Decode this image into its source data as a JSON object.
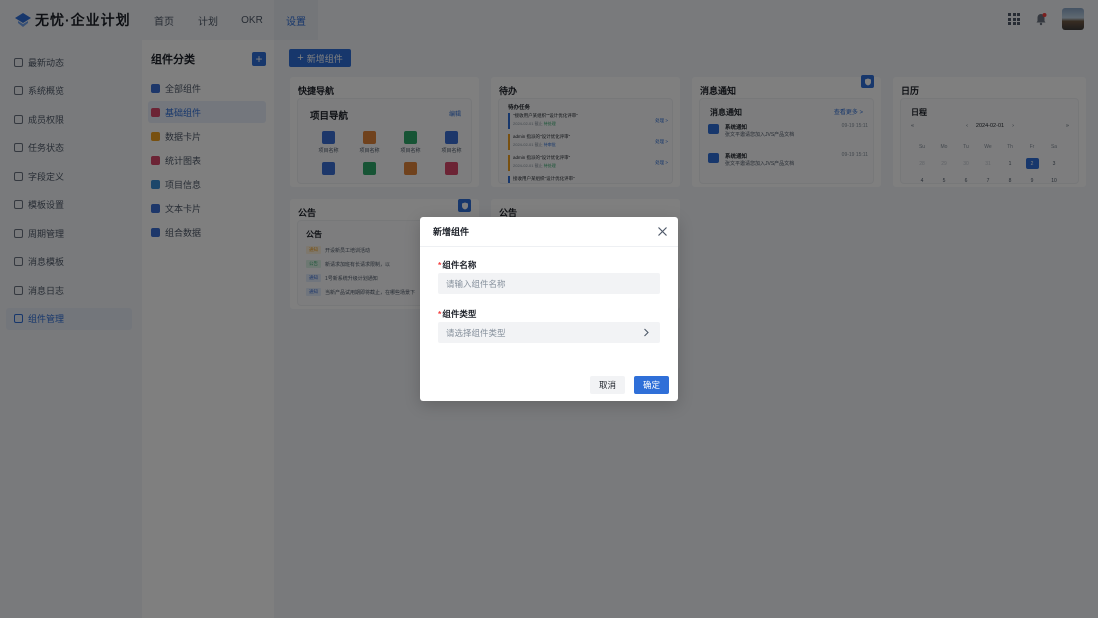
{
  "app": {
    "title": "无忧·企业计划"
  },
  "topnav": [
    {
      "label": "首页",
      "active": false
    },
    {
      "label": "计划",
      "active": false
    },
    {
      "label": "OKR",
      "active": false
    },
    {
      "label": "设置",
      "active": true
    }
  ],
  "sidebar": {
    "items": [
      {
        "label": "最新动态",
        "icon": "send-icon"
      },
      {
        "label": "系统概览",
        "icon": "sliders-icon"
      },
      {
        "label": "成员权限",
        "icon": "key-icon"
      },
      {
        "label": "任务状态",
        "icon": "checklist-icon"
      },
      {
        "label": "字段定义",
        "icon": "text-icon"
      },
      {
        "label": "模板设置",
        "icon": "template-icon"
      },
      {
        "label": "周期管理",
        "icon": "clock-icon"
      },
      {
        "label": "消息模板",
        "icon": "bell-icon"
      },
      {
        "label": "消息日志",
        "icon": "log-icon"
      },
      {
        "label": "组件管理",
        "icon": "component-icon",
        "active": true
      }
    ]
  },
  "categories": {
    "title": "组件分类",
    "items": [
      {
        "label": "全部组件",
        "color": "#3b6fd4"
      },
      {
        "label": "基础组件",
        "color": "#d9486b",
        "active": true
      },
      {
        "label": "数据卡片",
        "color": "#f0a020"
      },
      {
        "label": "统计图表",
        "color": "#d9486b"
      },
      {
        "label": "项目信息",
        "color": "#3b8fd4"
      },
      {
        "label": "文本卡片",
        "color": "#3b6fd4"
      },
      {
        "label": "组合数据",
        "color": "#3b6fd4"
      }
    ]
  },
  "main": {
    "new_button": "新增组件",
    "cards": {
      "quicknav": {
        "title": "快捷导航",
        "inner_title": "项目导航",
        "link": "编辑",
        "items": [
          {
            "label": "项目名称",
            "color": "#3b6fd4"
          },
          {
            "label": "项目名称",
            "color": "#e0843a"
          },
          {
            "label": "项目名称",
            "color": "#2fa86a"
          },
          {
            "label": "项目名称",
            "color": "#3b6fd4"
          },
          {
            "label": "",
            "color": "#3b6fd4"
          },
          {
            "label": "",
            "color": "#2fa86a"
          },
          {
            "label": "",
            "color": "#e0843a"
          },
          {
            "label": "",
            "color": "#d9486b"
          }
        ]
      },
      "todo": {
        "title": "待办",
        "inner_title": "待办任务",
        "items": [
          {
            "text": "\"接收用户某组织\"\"设计优化评审\"",
            "sub": "2024-02-01 截止",
            "tag": "待处理",
            "action": "处理 >"
          },
          {
            "text": "admin 指派的\"设计优化评审\"",
            "sub": "2024-02-01 截止",
            "tag": "待审批",
            "action": "处理 >"
          },
          {
            "text": "admin 指派的\"设计优化评审\"",
            "sub": "2024-02-01 截止",
            "tag": "待处理",
            "action": "处理 >"
          },
          {
            "text": "接收用户某组织\"设计优化评审\"",
            "sub": "",
            "tag": "",
            "action": ""
          }
        ]
      },
      "messages": {
        "title": "消息通知",
        "inner_title": "消息通知",
        "link": "查看更多 >",
        "items": [
          {
            "title": "系统通知",
            "text": "张文平邀请您加入JVS产品文档",
            "date": "09-19 15:11"
          },
          {
            "title": "系统通知",
            "text": "张文平邀请您加入JVS产品文档",
            "date": "09-19 15:11"
          }
        ]
      },
      "calendar": {
        "title": "日历",
        "inner_title": "日程",
        "nav": {
          "prev_year": "«",
          "prev": "‹",
          "date": "2024-02-01",
          "next": "›",
          "next_year": "»"
        },
        "weekdays": [
          "Su",
          "Mo",
          "Tu",
          "We",
          "Th",
          "Fr",
          "Sa"
        ],
        "days": [
          {
            "d": "28",
            "dim": true
          },
          {
            "d": "29",
            "dim": true
          },
          {
            "d": "30",
            "dim": true
          },
          {
            "d": "31",
            "dim": true
          },
          {
            "d": "1"
          },
          {
            "d": "2",
            "sel": true
          },
          {
            "d": "3"
          },
          {
            "d": "4"
          },
          {
            "d": "5"
          },
          {
            "d": "6"
          },
          {
            "d": "7"
          },
          {
            "d": "8"
          },
          {
            "d": "9"
          },
          {
            "d": "10"
          }
        ]
      },
      "announce": {
        "title": "公告",
        "inner_title": "公告",
        "items": [
          {
            "tag": "通知",
            "tag_color": "#f0a020",
            "text": "开设新员工培训活动"
          },
          {
            "tag": "公告",
            "tag_color": "#2fa86a",
            "text": "新请求加班有长请求限制，以"
          },
          {
            "tag": "通知",
            "tag_color": "#3b6fd4",
            "text": "1号新系统升级计划通知"
          },
          {
            "tag": "通知",
            "tag_color": "#3b6fd4",
            "text": "当新产品试用期即将截止，在哪些场景下"
          }
        ]
      },
      "announce2": {
        "title": "公告"
      }
    }
  },
  "modal": {
    "title": "新增组件",
    "name_label": "组件名称",
    "name_placeholder": "请输入组件名称",
    "type_label": "组件类型",
    "type_placeholder": "请选择组件类型",
    "cancel": "取消",
    "ok": "确定"
  }
}
